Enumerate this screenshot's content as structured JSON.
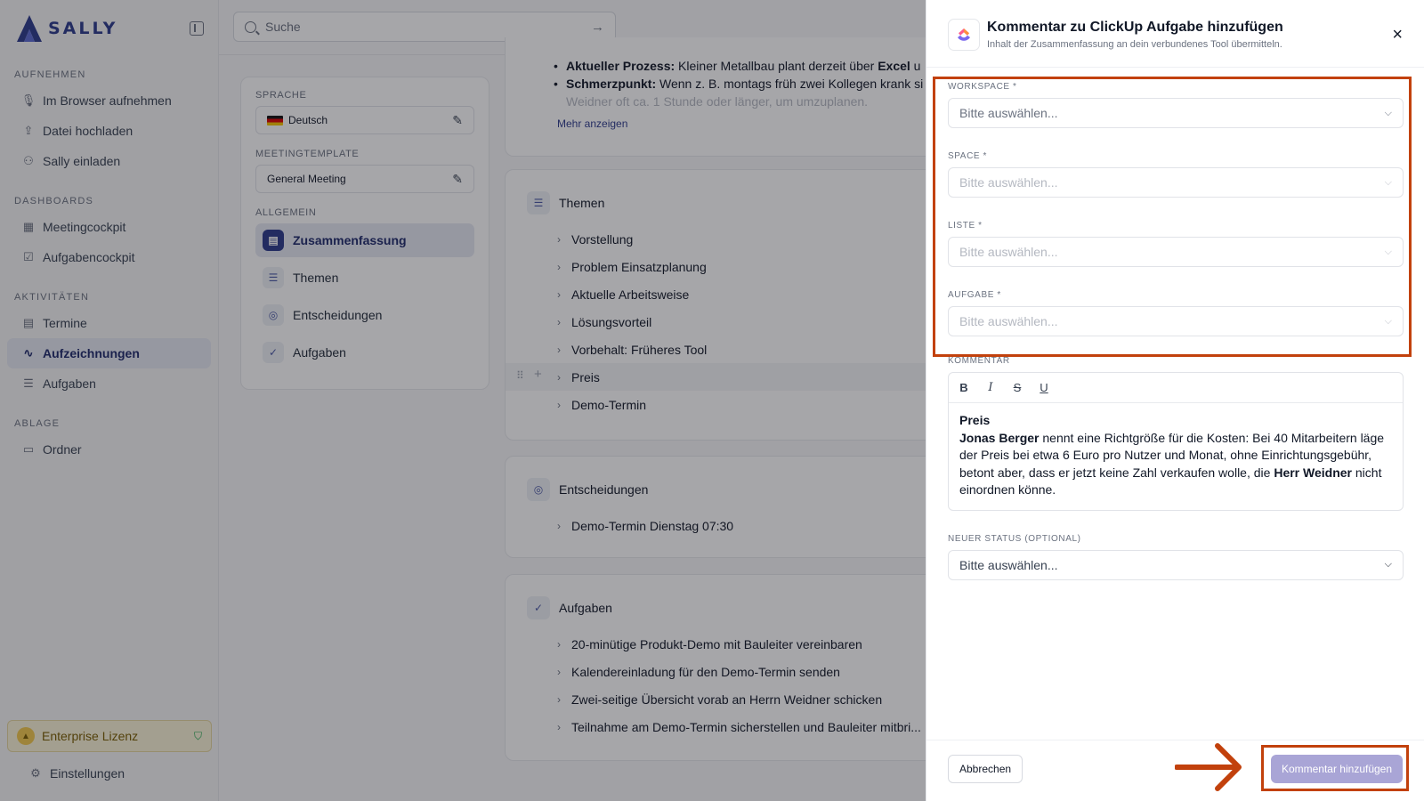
{
  "brand": {
    "name": "SALLY"
  },
  "search": {
    "placeholder": "Suche"
  },
  "sidebar": {
    "sections": [
      {
        "label": "AUFNEHMEN",
        "items": [
          {
            "label": "Im Browser aufnehmen",
            "icon": "microphone-icon"
          },
          {
            "label": "Datei hochladen",
            "icon": "upload-icon"
          },
          {
            "label": "Sally einladen",
            "icon": "user-plus-icon"
          }
        ]
      },
      {
        "label": "DASHBOARDS",
        "items": [
          {
            "label": "Meetingcockpit",
            "icon": "grid-icon"
          },
          {
            "label": "Aufgabencockpit",
            "icon": "check-square-icon"
          }
        ]
      },
      {
        "label": "AKTIVITÄTEN",
        "items": [
          {
            "label": "Termine",
            "icon": "calendar-icon"
          },
          {
            "label": "Aufzeichnungen",
            "icon": "waveform-icon",
            "active": true
          },
          {
            "label": "Aufgaben",
            "icon": "list-check-icon"
          }
        ]
      },
      {
        "label": "ABLAGE",
        "items": [
          {
            "label": "Ordner",
            "icon": "folder-icon"
          }
        ]
      }
    ],
    "license": "Enterprise Lizenz",
    "settings": "Einstellungen"
  },
  "meta": {
    "language_label": "SPRACHE",
    "language_value": "Deutsch",
    "template_label": "MEETINGTEMPLATE",
    "template_value": "General Meeting",
    "general_label": "ALLGEMEIN",
    "items": [
      {
        "label": "Zusammenfassung",
        "active": true
      },
      {
        "label": "Themen"
      },
      {
        "label": "Entscheidungen"
      },
      {
        "label": "Aufgaben"
      }
    ]
  },
  "summary": {
    "bullets": [
      {
        "bold": "Aktueller Prozess:",
        "text": " Kleiner Metallbau plant derzeit über ",
        "bold2": "Excel",
        "text2": " u"
      },
      {
        "bold": "Schmerzpunkt:",
        "text": " Wenn z. B. montags früh zwei Kollegen krank si"
      },
      {
        "text": "Weidner oft ca. 1 Stunde oder länger, um umzuplanen."
      }
    ],
    "more": "Mehr anzeigen"
  },
  "topics": {
    "title": "Themen",
    "items": [
      "Vorstellung",
      "Problem Einsatzplanung",
      "Aktuelle Arbeitsweise",
      "Lösungsvorteil",
      "Vorbehalt: Früheres Tool",
      "Preis",
      "Demo-Termin"
    ]
  },
  "decisions": {
    "title": "Entscheidungen",
    "items": [
      "Demo-Termin Dienstag 07:30"
    ]
  },
  "tasks": {
    "title": "Aufgaben",
    "items": [
      "20-minütige Produkt-Demo mit Bauleiter vereinbaren",
      "Kalendereinladung für den Demo-Termin senden",
      "Zwei-seitige Übersicht vorab an Herrn Weidner schicken",
      "Teilnahme am Demo-Termin sicherstellen und Bauleiter mitbri..."
    ]
  },
  "drawer": {
    "title": "Kommentar zu ClickUp Aufgabe hinzufügen",
    "subtitle": "Inhalt der Zusammenfassung an dein verbundenes Tool übermitteln.",
    "fields": [
      {
        "label": "WORKSPACE *",
        "placeholder": "Bitte auswählen...",
        "disabled": false
      },
      {
        "label": "SPACE *",
        "placeholder": "Bitte auswählen...",
        "disabled": true
      },
      {
        "label": "LISTE *",
        "placeholder": "Bitte auswählen...",
        "disabled": true
      },
      {
        "label": "AUFGABE *",
        "placeholder": "Bitte auswählen...",
        "disabled": true
      }
    ],
    "comment_label": "KOMMENTAR",
    "comment": {
      "heading": "Preis",
      "p1_bold": "Jonas Berger",
      "p1": " nennt eine Richtgröße für die Kosten: Bei 40 Mitarbeitern läge der Preis bei etwa 6 Euro pro Nutzer und Monat, ohne Einrichtungsgebühr, betont aber, dass er jetzt keine Zahl verkaufen wolle, die ",
      "p1_bold2": "Herr Weidner",
      "p1_end": " nicht einordnen könne."
    },
    "status_label": "NEUER STATUS (OPTIONAL)",
    "status_placeholder": "Bitte auswählen...",
    "cancel": "Abbrechen",
    "submit": "Kommentar hinzufügen"
  },
  "colors": {
    "accent": "#2d3a8c",
    "highlight": "#c2410c",
    "submit_disabled": "#a9a5d6",
    "license_bg": "#fbf4d7"
  }
}
